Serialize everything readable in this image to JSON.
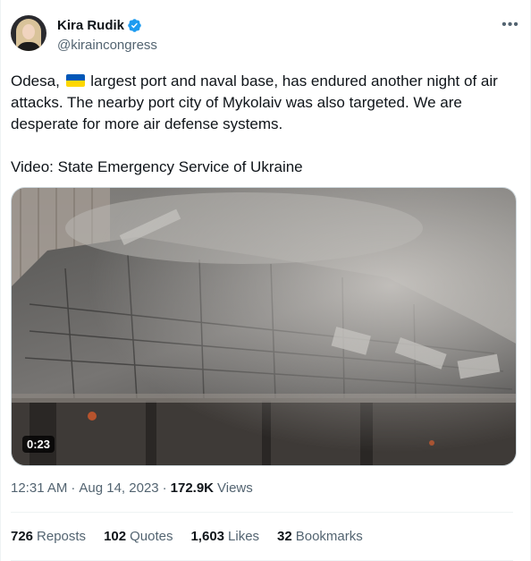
{
  "author": {
    "display_name": "Kira Rudik",
    "handle": "@kiraincongress",
    "avatar_icon": "profile-photo"
  },
  "colors": {
    "verified": "#1d9bf0",
    "text": "#0f1419",
    "secondary": "#536471",
    "flag_blue": "#0057b7",
    "flag_yellow": "#ffd700"
  },
  "tweet": {
    "text_prefix": "Odesa,",
    "flag_emoji_icon": "ukraine-flag-icon",
    "text_line1_rest": " largest port and naval base, has endured another night of air attacks. The nearby port city of Mykolaiv was also targeted. We are desperate for more air defense systems.",
    "credit": "Video: State Emergency Service of Ukraine"
  },
  "video": {
    "duration": "0:23"
  },
  "meta": {
    "time": "12:31 AM",
    "separator": "·",
    "date": "Aug 14, 2023",
    "views_count": "172.9K",
    "views_label": "Views"
  },
  "stats": [
    {
      "count": "726",
      "label": "Reposts"
    },
    {
      "count": "102",
      "label": "Quotes"
    },
    {
      "count": "1,603",
      "label": "Likes"
    },
    {
      "count": "32",
      "label": "Bookmarks"
    }
  ]
}
